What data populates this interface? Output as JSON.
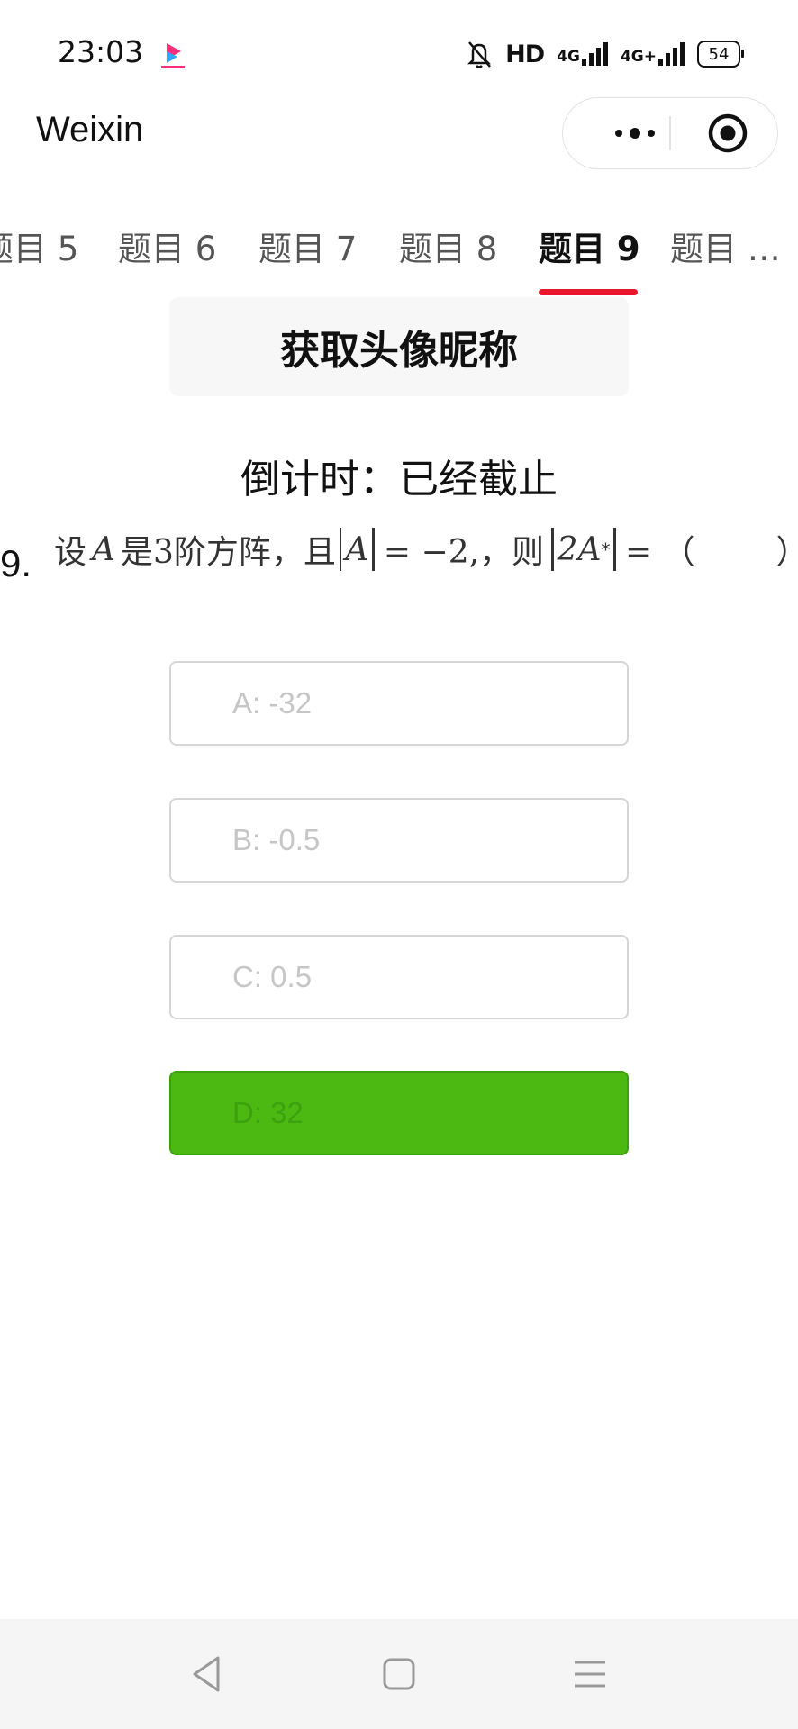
{
  "status_bar": {
    "time": "23:03",
    "app_badge_icon": "youku-icon",
    "mute_icon": "bell-off-icon",
    "hd_label": "HD",
    "signal1_label": "4G",
    "signal2_label": "4G+",
    "battery_level": "54"
  },
  "nav": {
    "title": "Weixin",
    "more_icon": "more-dots-icon",
    "close_icon": "target-circle-icon"
  },
  "tabs": [
    {
      "label": "题目 5"
    },
    {
      "label": "题目 6"
    },
    {
      "label": "题目 7"
    },
    {
      "label": "题目 8"
    },
    {
      "label": "题目 9"
    },
    {
      "label": "题目 …"
    }
  ],
  "active_tab": "题目 9",
  "nickname_button": "获取头像昵称",
  "countdown": "倒计时：已经截止",
  "question": {
    "number": "9.",
    "prefix": "设",
    "var": "A",
    "middle": "是3阶方阵，且",
    "eq1": "= −2,，则",
    "expr": "2A",
    "star": "*",
    "suffix": "= （",
    "close": "）"
  },
  "options": [
    {
      "label": "A: -32",
      "correct": false
    },
    {
      "label": "B: -0.5",
      "correct": false
    },
    {
      "label": "C: 0.5",
      "correct": false
    },
    {
      "label": "D: 32",
      "correct": true
    }
  ],
  "colors": {
    "accent_red": "#e8192c",
    "correct_green": "#4cb913"
  }
}
